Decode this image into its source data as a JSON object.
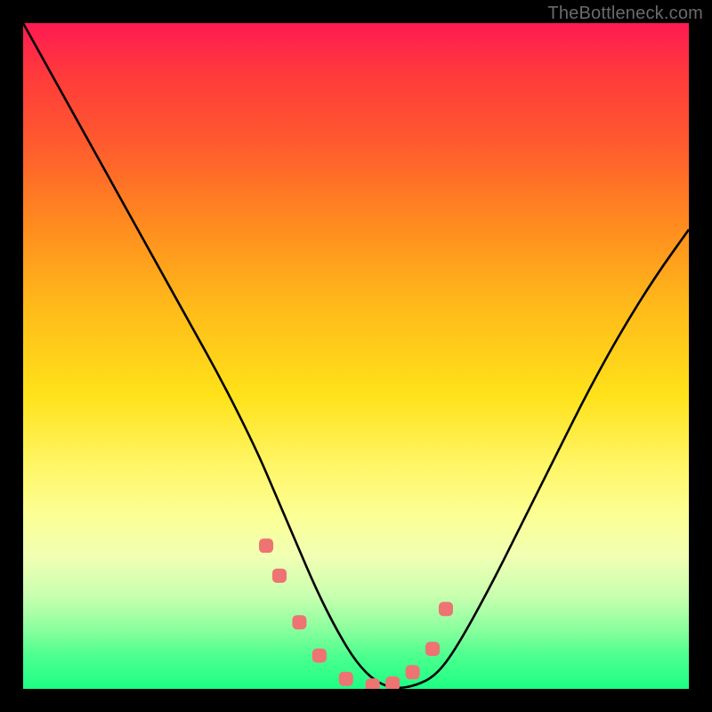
{
  "watermark": "TheBottleneck.com",
  "chart_data": {
    "type": "line",
    "title": "",
    "xlabel": "",
    "ylabel": "",
    "xlim": [
      0,
      100
    ],
    "ylim": [
      0,
      100
    ],
    "x": [
      0,
      5,
      10,
      15,
      20,
      25,
      30,
      35,
      38,
      41,
      44,
      47,
      50,
      53,
      56,
      59,
      62,
      65,
      70,
      75,
      80,
      85,
      90,
      95,
      100
    ],
    "values": [
      100,
      91,
      82,
      73,
      64,
      55,
      46,
      36,
      29,
      22,
      15,
      9,
      4,
      1,
      0,
      0.5,
      2,
      6,
      15,
      25,
      35,
      45,
      54,
      62,
      69
    ],
    "markers_x": [
      36.5,
      38.5,
      41.5,
      44.5,
      48.5,
      52.5,
      55.5,
      58.5,
      61.5,
      63.5
    ],
    "markers_y": [
      21.5,
      17,
      10,
      5,
      1.5,
      0.5,
      0.8,
      2.5,
      6,
      12
    ],
    "marker_color": "#ee7373",
    "line_color": "#000000",
    "grid": false,
    "legend": false
  }
}
